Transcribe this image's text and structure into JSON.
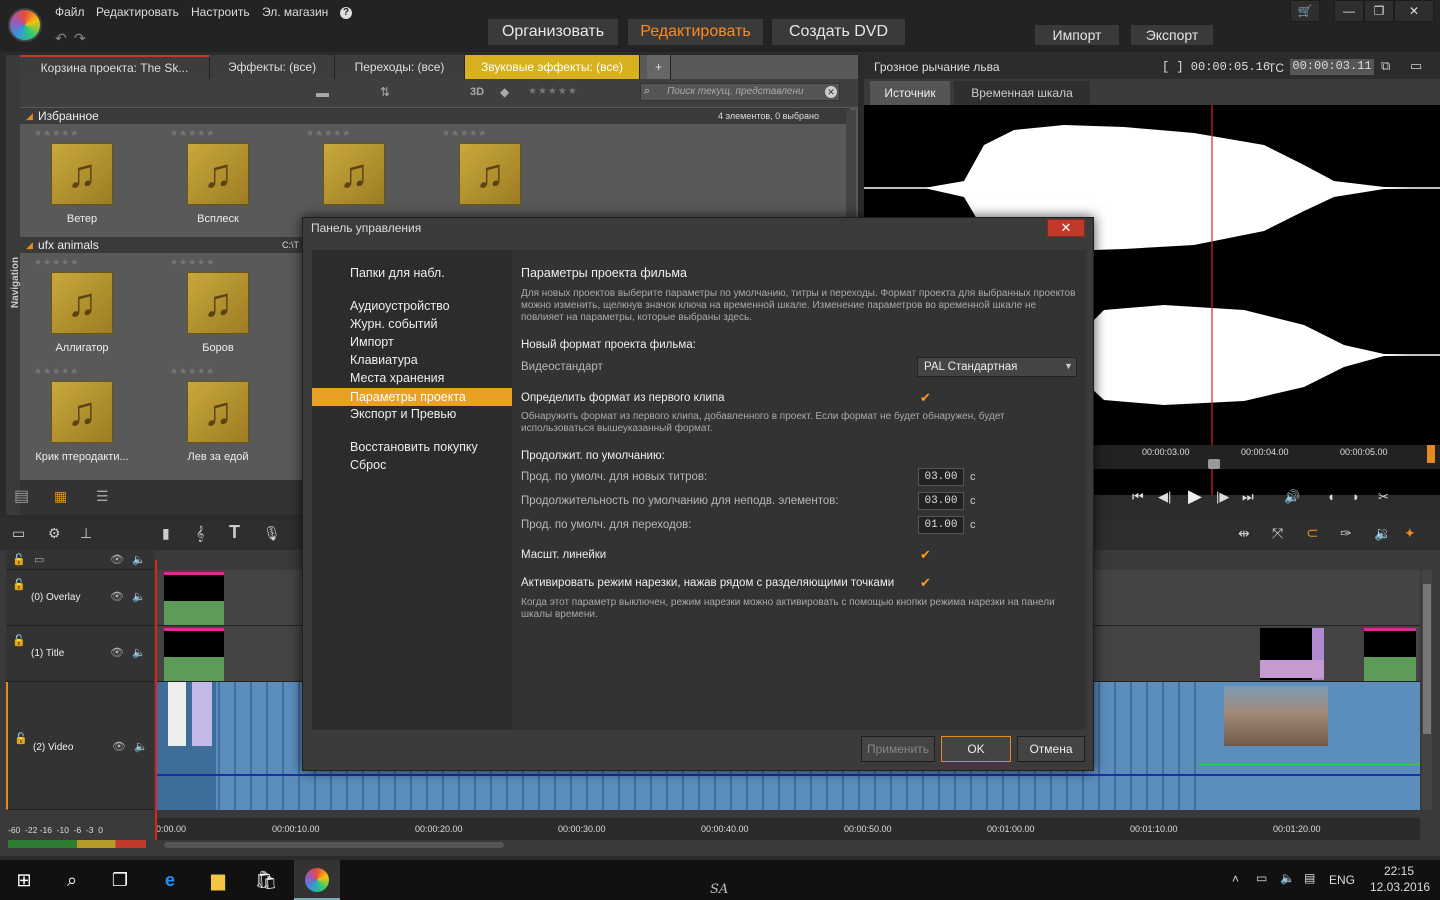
{
  "app": {
    "menu": [
      "Файл",
      "Редактировать",
      "Настроить",
      "Эл. магазин",
      "?"
    ],
    "modes": [
      "Организовать",
      "Редактировать",
      "Создать DVD"
    ],
    "active_mode": "Редактировать",
    "import_label": "Импорт",
    "export_label": "Экспорт"
  },
  "library": {
    "tabs": [
      "Корзина проекта: The Sk...",
      "Эффекты: (все)",
      "Переходы: (все)",
      "Звуковые эффекты: (все)"
    ],
    "search_placeholder": "Поиск текущ. представлени",
    "toolbar_3d": "3D",
    "nav_label": "Navigation",
    "favorites": {
      "title": "Избранное",
      "count_text": "4 элементов, 0 выбрано",
      "items": [
        "Ветер",
        "Всплеск"
      ]
    },
    "ufx": {
      "title": "ufx animals",
      "path": "C:\\T",
      "items": [
        "Аллигатор",
        "Боров",
        "Крик птеродакти...",
        "Лев за едой"
      ]
    }
  },
  "player": {
    "clip_title": "Грозное рычание льва",
    "duration": "[ ] 00:00:05.16",
    "tc_label": "TC",
    "timecode": "00:00:03.11",
    "tabs": [
      "Источник",
      "Временная шкала"
    ],
    "ruler": [
      "00:00:03.00",
      "00:00:04.00",
      "00:00:05.00"
    ]
  },
  "timeline": {
    "tracks": [
      "(0) Overlay",
      "(1) Title",
      "(2) Video"
    ],
    "ruler": [
      "0:00.00",
      "00:00:10.00",
      "00:00:20.00",
      "00:00:30.00",
      "00:00:40.00",
      "00:00:50.00",
      "00:01:00.00",
      "00:01:10.00",
      "00:01:20.00"
    ],
    "meter_labels": "-60  -22 -16  -10  -6  -3  0"
  },
  "dialog": {
    "title": "Панель управления",
    "close": "✕",
    "nav": [
      "Папки для набл.",
      "Аудиоустройство",
      "Журн. событий",
      "Импорт",
      "Клавиатура",
      "Места хранения",
      "Параметры проекта",
      "Экспорт и Превью",
      "Восстановить покупку",
      "Сброс"
    ],
    "selected_nav": "Параметры проекта",
    "heading": "Параметры проекта фильма",
    "intro": "Для новых проектов выберите параметры по умолчанию, титры и переходы. Формат проекта для выбранных проектов можно изменить, щелкнув значок ключа на временной шкале. Изменение параметров во временной шкале не повлияет на параметры, которые выбраны здесь.",
    "new_format_label": "Новый формат проекта фильма:",
    "video_standard_label": "Видеостандарт",
    "video_standard_value": "PAL Стандартная",
    "detect_label": "Определить формат из первого клипа",
    "detect_desc": "Обнаружить формат из первого клипа, добавленного в проект. Если формат не будет обнаружен, будет использоваться вышеуказанный формат.",
    "durations_label": "Продолжит. по умолчанию:",
    "titles_label": "Прод. по умолч. для новых титров:",
    "titles_value": "03.00",
    "still_label": "Продолжительность по умолчанию для неподв. элементов:",
    "still_value": "03.00",
    "transitions_label": "Прод. по умолч. для переходов:",
    "transitions_value": "01.00",
    "unit": "с",
    "ruler_scale_label": "Масшт. линейки",
    "trim_label": "Активировать режим нарезки, нажав рядом с разделяющими точками",
    "trim_desc": "Когда этот параметр выключен, режим нарезки можно активировать с помощью кнопки режима нарезки на панели шкалы времени.",
    "apply": "Применить",
    "ok": "OK",
    "cancel": "Отмена"
  },
  "taskbar": {
    "lang": "ENG",
    "time": "22:15",
    "date": "12.03.2016",
    "watermark": "SA"
  }
}
